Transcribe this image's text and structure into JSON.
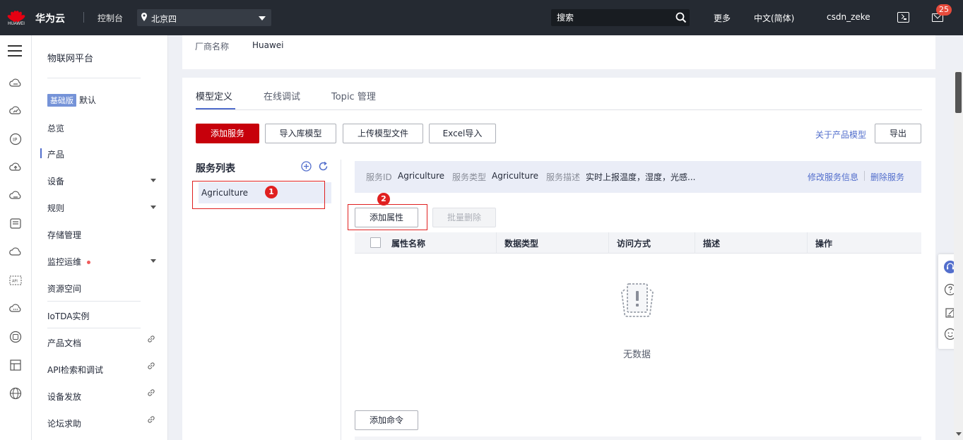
{
  "topbar": {
    "logo_text": "HUAWEI",
    "brand": "华为云",
    "console": "控制台",
    "region": "北京四",
    "search_placeholder": "搜索",
    "more": "更多",
    "language": "中文(简体)",
    "username": "csdn_zeke",
    "notifications": "25"
  },
  "submenu": {
    "title": "物联网平台",
    "edition_tag": "基础版",
    "edition_label": "默认",
    "items": {
      "overview": "总览",
      "products": "产品",
      "devices": "设备",
      "rules": "规则",
      "storage": "存储管理",
      "monitoring": "监控运维",
      "resource_space": "资源空间",
      "iotda": "IoTDA实例",
      "docs": "产品文档",
      "api": "API检索和调试",
      "provisioning": "设备发放",
      "forum": "论坛求助"
    }
  },
  "top_card": {
    "vendor_label": "厂商名称",
    "vendor_value": "Huawei"
  },
  "tabs": [
    "模型定义",
    "在线调试",
    "Topic 管理"
  ],
  "toolbar": {
    "add_service": "添加服务",
    "import_library": "导入库模型",
    "upload_model": "上传模型文件",
    "excel_import": "Excel导入",
    "about_link": "关于产品模型",
    "export": "导出"
  },
  "services": {
    "title": "服务列表",
    "items": [
      "Agriculture"
    ]
  },
  "service_info": {
    "id_label": "服务ID",
    "id_value": "Agriculture",
    "type_label": "服务类型",
    "type_value": "Agriculture",
    "desc_label": "服务描述",
    "desc_value": "实时上报温度，湿度，光感...",
    "edit_link": "修改服务信息",
    "delete_link": "删除服务"
  },
  "properties": {
    "add_button": "添加属性",
    "batch_delete": "批量删除",
    "columns": [
      "属性名称",
      "数据类型",
      "访问方式",
      "描述",
      "操作"
    ],
    "empty_text": "无数据"
  },
  "commands": {
    "add_button": "添加命令"
  },
  "annotations": [
    "1",
    "2"
  ],
  "colors": {
    "primary": "#c7000b",
    "accent": "#526ecc",
    "topbar": "#252a32"
  }
}
